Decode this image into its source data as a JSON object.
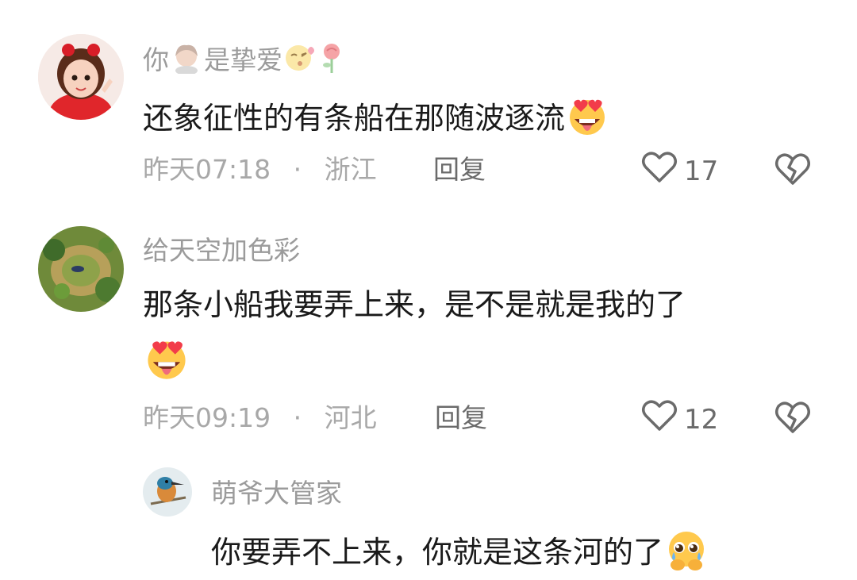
{
  "comments": [
    {
      "username": "你",
      "username_mid": "是挚爱",
      "text": "还象征性的有条船在那随波逐流",
      "time": "昨天07:18",
      "sep": "·",
      "location": "浙江",
      "reply": "回复",
      "likes": "17"
    },
    {
      "username": "给天空加色彩",
      "text": "那条小船我要弄上来，是不是就是我的了",
      "time": "昨天09:19",
      "sep": "·",
      "location": "河北",
      "reply": "回复",
      "likes": "12"
    }
  ],
  "sub_reply": {
    "username": "萌爷大管家",
    "text": "你要弄不上来，你就是这条河的了"
  },
  "icons": {
    "like": "heart-outline-icon",
    "dislike": "broken-heart-icon"
  }
}
